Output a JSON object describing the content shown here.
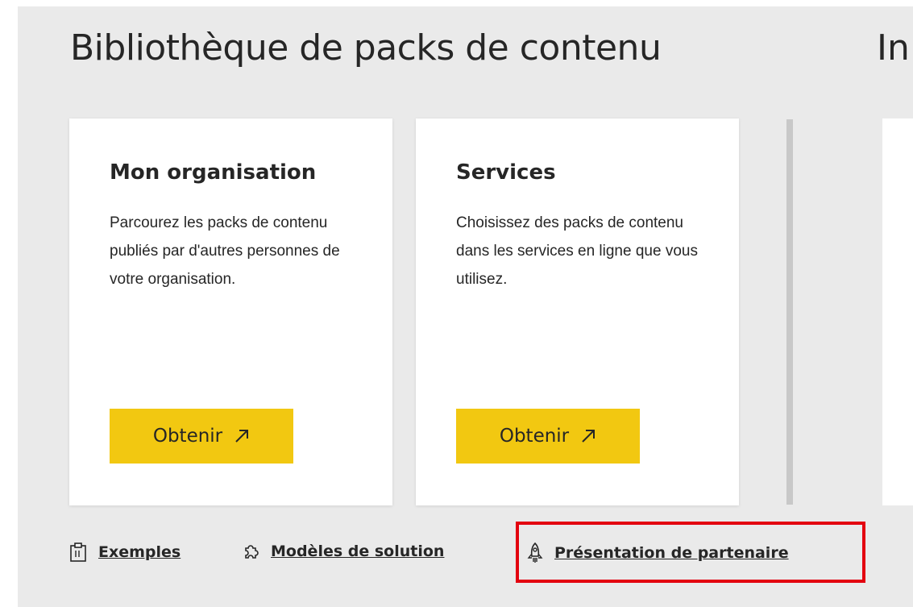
{
  "header": {
    "title": "Bibliothèque de packs de contenu",
    "title_partial": "In"
  },
  "cards": [
    {
      "title": "Mon organisation",
      "description": "Parcourez les packs de contenu publiés par d'autres personnes de votre organisation.",
      "button_label": "Obtenir",
      "button_icon": "arrow-up-right-icon"
    },
    {
      "title": "Services",
      "description": "Choisissez des packs de contenu dans les services en ligne que vous utilisez.",
      "button_label": "Obtenir",
      "button_icon": "arrow-up-right-icon"
    }
  ],
  "links": [
    {
      "label": "Exemples",
      "icon": "clipboard-icon"
    },
    {
      "label": "Modèles de solution",
      "icon": "puzzle-icon"
    },
    {
      "label": "Présentation de partenaire",
      "icon": "rocket-icon"
    }
  ],
  "colors": {
    "accent": "#f2c811",
    "highlight": "#e3000f",
    "background": "#eaeaea",
    "card": "#ffffff",
    "text": "#262626"
  }
}
